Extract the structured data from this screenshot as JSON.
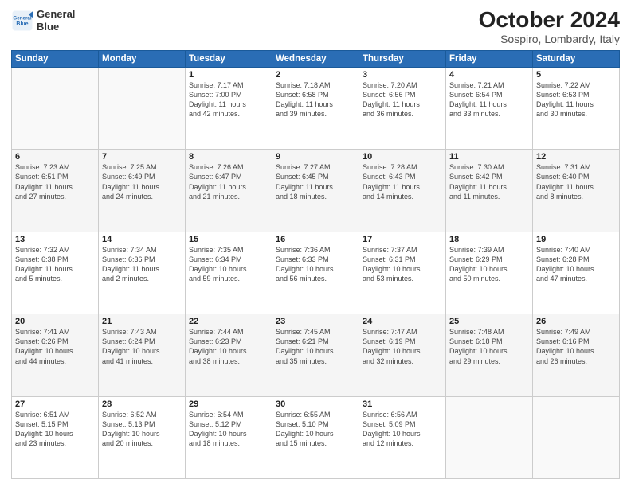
{
  "logo": {
    "line1": "General",
    "line2": "Blue"
  },
  "title": "October 2024",
  "subtitle": "Sospiro, Lombardy, Italy",
  "days_header": [
    "Sunday",
    "Monday",
    "Tuesday",
    "Wednesday",
    "Thursday",
    "Friday",
    "Saturday"
  ],
  "weeks": [
    [
      {
        "num": "",
        "info": ""
      },
      {
        "num": "",
        "info": ""
      },
      {
        "num": "1",
        "info": "Sunrise: 7:17 AM\nSunset: 7:00 PM\nDaylight: 11 hours\nand 42 minutes."
      },
      {
        "num": "2",
        "info": "Sunrise: 7:18 AM\nSunset: 6:58 PM\nDaylight: 11 hours\nand 39 minutes."
      },
      {
        "num": "3",
        "info": "Sunrise: 7:20 AM\nSunset: 6:56 PM\nDaylight: 11 hours\nand 36 minutes."
      },
      {
        "num": "4",
        "info": "Sunrise: 7:21 AM\nSunset: 6:54 PM\nDaylight: 11 hours\nand 33 minutes."
      },
      {
        "num": "5",
        "info": "Sunrise: 7:22 AM\nSunset: 6:53 PM\nDaylight: 11 hours\nand 30 minutes."
      }
    ],
    [
      {
        "num": "6",
        "info": "Sunrise: 7:23 AM\nSunset: 6:51 PM\nDaylight: 11 hours\nand 27 minutes."
      },
      {
        "num": "7",
        "info": "Sunrise: 7:25 AM\nSunset: 6:49 PM\nDaylight: 11 hours\nand 24 minutes."
      },
      {
        "num": "8",
        "info": "Sunrise: 7:26 AM\nSunset: 6:47 PM\nDaylight: 11 hours\nand 21 minutes."
      },
      {
        "num": "9",
        "info": "Sunrise: 7:27 AM\nSunset: 6:45 PM\nDaylight: 11 hours\nand 18 minutes."
      },
      {
        "num": "10",
        "info": "Sunrise: 7:28 AM\nSunset: 6:43 PM\nDaylight: 11 hours\nand 14 minutes."
      },
      {
        "num": "11",
        "info": "Sunrise: 7:30 AM\nSunset: 6:42 PM\nDaylight: 11 hours\nand 11 minutes."
      },
      {
        "num": "12",
        "info": "Sunrise: 7:31 AM\nSunset: 6:40 PM\nDaylight: 11 hours\nand 8 minutes."
      }
    ],
    [
      {
        "num": "13",
        "info": "Sunrise: 7:32 AM\nSunset: 6:38 PM\nDaylight: 11 hours\nand 5 minutes."
      },
      {
        "num": "14",
        "info": "Sunrise: 7:34 AM\nSunset: 6:36 PM\nDaylight: 11 hours\nand 2 minutes."
      },
      {
        "num": "15",
        "info": "Sunrise: 7:35 AM\nSunset: 6:34 PM\nDaylight: 10 hours\nand 59 minutes."
      },
      {
        "num": "16",
        "info": "Sunrise: 7:36 AM\nSunset: 6:33 PM\nDaylight: 10 hours\nand 56 minutes."
      },
      {
        "num": "17",
        "info": "Sunrise: 7:37 AM\nSunset: 6:31 PM\nDaylight: 10 hours\nand 53 minutes."
      },
      {
        "num": "18",
        "info": "Sunrise: 7:39 AM\nSunset: 6:29 PM\nDaylight: 10 hours\nand 50 minutes."
      },
      {
        "num": "19",
        "info": "Sunrise: 7:40 AM\nSunset: 6:28 PM\nDaylight: 10 hours\nand 47 minutes."
      }
    ],
    [
      {
        "num": "20",
        "info": "Sunrise: 7:41 AM\nSunset: 6:26 PM\nDaylight: 10 hours\nand 44 minutes."
      },
      {
        "num": "21",
        "info": "Sunrise: 7:43 AM\nSunset: 6:24 PM\nDaylight: 10 hours\nand 41 minutes."
      },
      {
        "num": "22",
        "info": "Sunrise: 7:44 AM\nSunset: 6:23 PM\nDaylight: 10 hours\nand 38 minutes."
      },
      {
        "num": "23",
        "info": "Sunrise: 7:45 AM\nSunset: 6:21 PM\nDaylight: 10 hours\nand 35 minutes."
      },
      {
        "num": "24",
        "info": "Sunrise: 7:47 AM\nSunset: 6:19 PM\nDaylight: 10 hours\nand 32 minutes."
      },
      {
        "num": "25",
        "info": "Sunrise: 7:48 AM\nSunset: 6:18 PM\nDaylight: 10 hours\nand 29 minutes."
      },
      {
        "num": "26",
        "info": "Sunrise: 7:49 AM\nSunset: 6:16 PM\nDaylight: 10 hours\nand 26 minutes."
      }
    ],
    [
      {
        "num": "27",
        "info": "Sunrise: 6:51 AM\nSunset: 5:15 PM\nDaylight: 10 hours\nand 23 minutes."
      },
      {
        "num": "28",
        "info": "Sunrise: 6:52 AM\nSunset: 5:13 PM\nDaylight: 10 hours\nand 20 minutes."
      },
      {
        "num": "29",
        "info": "Sunrise: 6:54 AM\nSunset: 5:12 PM\nDaylight: 10 hours\nand 18 minutes."
      },
      {
        "num": "30",
        "info": "Sunrise: 6:55 AM\nSunset: 5:10 PM\nDaylight: 10 hours\nand 15 minutes."
      },
      {
        "num": "31",
        "info": "Sunrise: 6:56 AM\nSunset: 5:09 PM\nDaylight: 10 hours\nand 12 minutes."
      },
      {
        "num": "",
        "info": ""
      },
      {
        "num": "",
        "info": ""
      }
    ]
  ]
}
